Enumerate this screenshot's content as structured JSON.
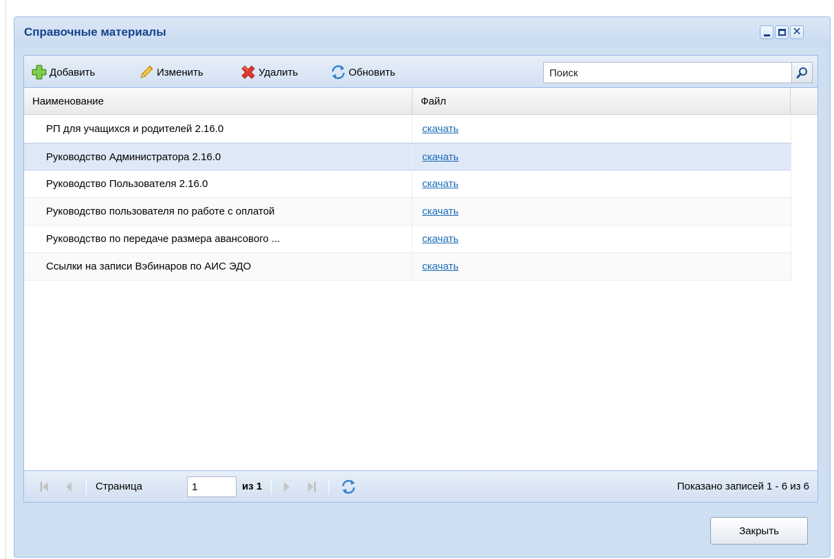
{
  "window": {
    "title": "Справочные материалы",
    "controls": {
      "minimize": "minimize-icon",
      "maximize": "maximize-icon",
      "close": "close-icon"
    }
  },
  "toolbar": {
    "add_label": "Добавить",
    "edit_label": "Изменить",
    "delete_label": "Удалить",
    "refresh_label": "Обновить",
    "search_placeholder": "Поиск"
  },
  "grid": {
    "columns": {
      "name": "Наименование",
      "file": "Файл"
    },
    "rows": [
      {
        "name": "РП для учащихся и родителей 2.16.0",
        "file": "скачать"
      },
      {
        "name": "Руководство Администратора 2.16.0",
        "file": "скачать"
      },
      {
        "name": "Руководство Пользователя 2.16.0",
        "file": "скачать"
      },
      {
        "name": "Руководство пользователя по работе с оплатой",
        "file": "скачать"
      },
      {
        "name": "Руководство по передаче размера авансового ...",
        "file": "скачать"
      },
      {
        "name": "Ссылки на записи Вэбинаров по АИС ЭДО",
        "file": "скачать"
      }
    ],
    "selected_row": 1
  },
  "pager": {
    "page_label": "Страница",
    "page_value": "1",
    "of_label": "из 1",
    "info": "Показано записей 1 - 6 из 6"
  },
  "footer": {
    "close_label": "Закрыть"
  },
  "colors": {
    "title_text": "#15428b",
    "window_bg": "#cfdff2",
    "link": "#1a6ab9",
    "selection": "#dfe8f6"
  }
}
